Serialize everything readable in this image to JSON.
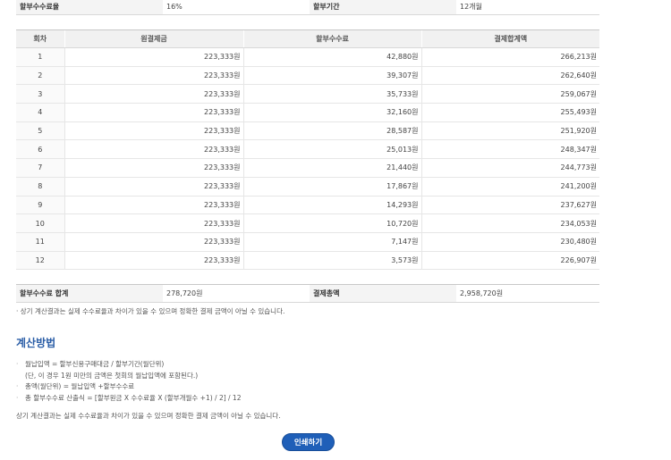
{
  "info": {
    "fee_rate_label": "할부수수료율",
    "fee_rate_value": "16%",
    "period_label": "할부기간",
    "period_value": "12개월"
  },
  "schedule": {
    "headers": [
      "회차",
      "원결제금",
      "할부수수료",
      "결제합계액"
    ],
    "rows": [
      [
        "1",
        "223,333원",
        "42,880원",
        "266,213원"
      ],
      [
        "2",
        "223,333원",
        "39,307원",
        "262,640원"
      ],
      [
        "3",
        "223,333원",
        "35,733원",
        "259,067원"
      ],
      [
        "4",
        "223,333원",
        "32,160원",
        "255,493원"
      ],
      [
        "5",
        "223,333원",
        "28,587원",
        "251,920원"
      ],
      [
        "6",
        "223,333원",
        "25,013원",
        "248,347원"
      ],
      [
        "7",
        "223,333원",
        "21,440원",
        "244,773원"
      ],
      [
        "8",
        "223,333원",
        "17,867원",
        "241,200원"
      ],
      [
        "9",
        "223,333원",
        "14,293원",
        "237,627원"
      ],
      [
        "10",
        "223,333원",
        "10,720원",
        "234,053원"
      ],
      [
        "11",
        "223,333원",
        "7,147원",
        "230,480원"
      ],
      [
        "12",
        "223,333원",
        "3,573원",
        "226,907원"
      ]
    ]
  },
  "summary": {
    "fee_total_label": "할부수수료 합계",
    "fee_total_value": "278,720원",
    "pay_total_label": "결제총액",
    "pay_total_value": "2,958,720원"
  },
  "note": "상기 계산결과는 실제 수수료율과 차이가 있을 수 있으며 정확한 결제 금액이 아닐 수 있습니다.",
  "method": {
    "title": "계산방법",
    "items": [
      {
        "bullet": "·",
        "text": "월납입액 = 할부신용구매대금 / 할부기간(월단위)"
      },
      {
        "bullet": "",
        "text": "(단, 이 경우 1원 미만의 금액은 첫회의 월납입액에 포함된다.)"
      },
      {
        "bullet": "·",
        "text": "총액(월단위) = 월납입액 +할부수수료"
      },
      {
        "bullet": "·",
        "text": "총 할부수수료 산출식 = [할부원금 X 수수료율 X (할부개월수 +1) / 2] / 12"
      }
    ],
    "note": "상기 계산결과는 실제 수수료율과 차이가 있을 수 있으며 정확한 결제 금액이 아닐 수 있습니다."
  },
  "print_button": "인쇄하기"
}
